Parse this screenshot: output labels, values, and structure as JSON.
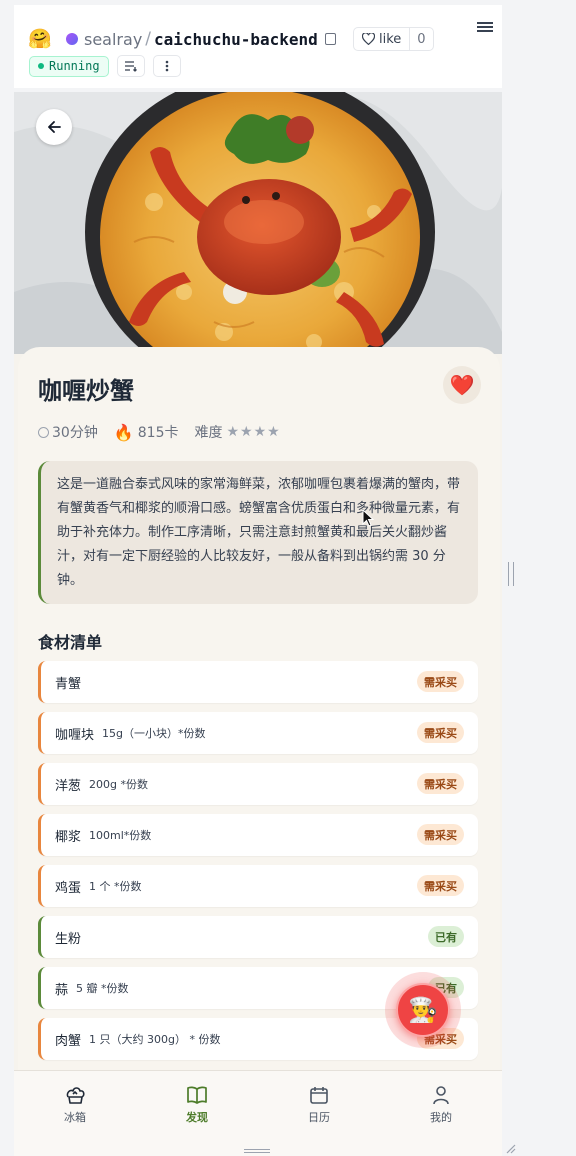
{
  "space_header": {
    "logo": "🤗",
    "owner": "sealray",
    "separator": "/",
    "repo": "caichuchu-backend",
    "like_label": "like",
    "like_count": "0",
    "status": "Running"
  },
  "recipe": {
    "title": "咖喱炒蟹",
    "favorite_icon": "❤️",
    "time": "30分钟",
    "calorie_icon": "🔥",
    "calories": "815卡",
    "difficulty_label": "难度",
    "difficulty_stars": "★★★★",
    "difficulty_value": 4,
    "description": "这是一道融合泰式风味的家常海鲜菜，浓郁咖喱包裹着爆满的蟹肉，带有蟹黄香气和椰浆的顺滑口感。螃蟹富含优质蛋白和多种微量元素，有助于补充体力。制作工序清晰，只需注意封煎蟹黄和最后关火翻炒酱汁，对有一定下厨经验的人比较友好，一般从备料到出锅约需 30 分钟。"
  },
  "ingredients_title": "食材清单",
  "ingredients": [
    {
      "name": "青蟹",
      "qty": "",
      "status": "需采买",
      "type": "buy"
    },
    {
      "name": "咖喱块",
      "qty": "15g（一小块）*份数",
      "status": "需采买",
      "type": "buy"
    },
    {
      "name": "洋葱",
      "qty": "200g *份数",
      "status": "需采买",
      "type": "buy"
    },
    {
      "name": "椰浆",
      "qty": "100ml*份数",
      "status": "需采买",
      "type": "buy"
    },
    {
      "name": "鸡蛋",
      "qty": "1 个 *份数",
      "status": "需采买",
      "type": "buy"
    },
    {
      "name": "生粉",
      "qty": "",
      "status": "已有",
      "type": "have"
    },
    {
      "name": "蒜",
      "qty": "5 瓣 *份数",
      "status": "已有",
      "type": "have"
    },
    {
      "name": "肉蟹",
      "qty": "1 只（大约 300g） * 份数",
      "status": "需采买",
      "type": "buy"
    }
  ],
  "fab_icon": "👨‍🍳",
  "tabs": [
    {
      "label": "冰箱",
      "icon": "fridge-icon"
    },
    {
      "label": "发现",
      "icon": "book-icon"
    },
    {
      "label": "日历",
      "icon": "calendar-icon"
    },
    {
      "label": "我的",
      "icon": "user-icon"
    }
  ],
  "colors": {
    "accent_green": "#4d7c2a",
    "buy_orange": "#e8863e",
    "fab_red": "#ef4444"
  }
}
